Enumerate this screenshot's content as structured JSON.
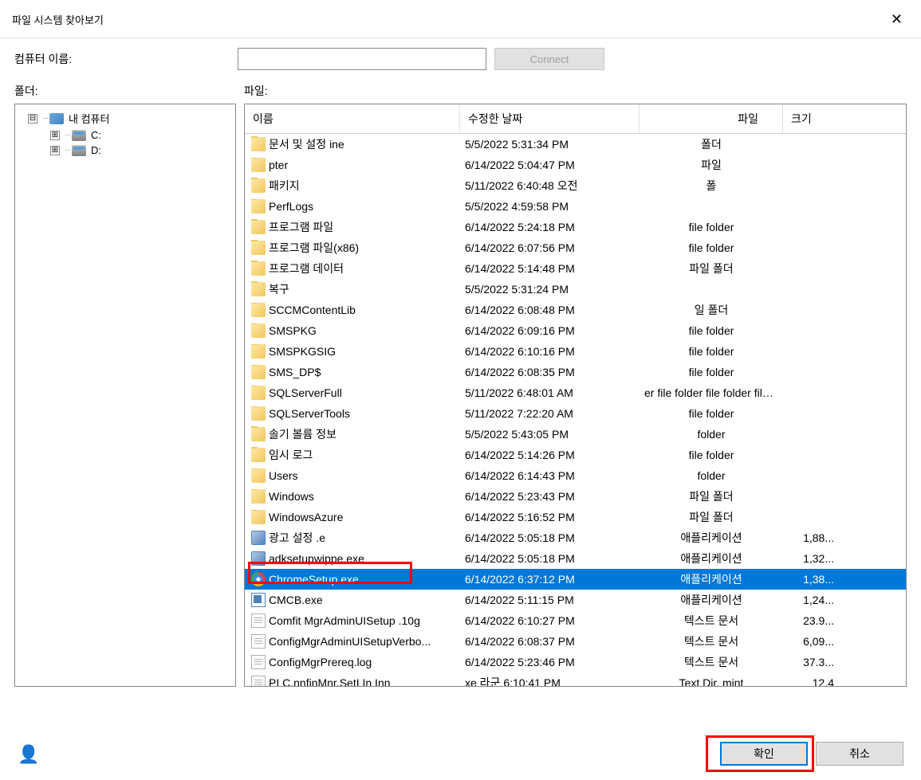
{
  "window": {
    "title": "파일 시스템 찾아보기",
    "close": "✕"
  },
  "labels": {
    "computer_name": "컴퓨터 이름:",
    "folder": "폴더:",
    "file": "파일:"
  },
  "buttons": {
    "connect": "Connect",
    "ok": "확인",
    "cancel": "취소"
  },
  "tree": {
    "root": "내 컴퓨터",
    "expander_minus": "⊟",
    "expander_plus": "⊞",
    "drives": [
      "C:",
      "D:"
    ]
  },
  "columns": {
    "name": "이름",
    "date": "수정한 날짜",
    "type": "파일",
    "size": "크기"
  },
  "files": [
    {
      "name": "문서 및 설정 ine",
      "date": "5/5/2022 5:31:34 PM",
      "type": "폴더",
      "size": "",
      "icon": "folder"
    },
    {
      "name": "pter",
      "date": "6/14/2022 5:04:47 PM",
      "type": "파일",
      "size": "",
      "icon": "folder"
    },
    {
      "name": "패키지",
      "date": "5/11/2022 6:40:48 오전",
      "type": "폴",
      "size": "",
      "icon": "folder"
    },
    {
      "name": "PerfLogs",
      "date": "5/5/2022 4:59:58 PM",
      "type": "",
      "size": "",
      "icon": "folder"
    },
    {
      "name": "프로그램 파일",
      "date": "6/14/2022 5:24:18 PM",
      "type": "file folder",
      "size": "",
      "icon": "folder"
    },
    {
      "name": "프로그램 파일(x86)",
      "date": "6/14/2022 6:07:56 PM",
      "type": "file folder",
      "size": "",
      "icon": "folder"
    },
    {
      "name": "프로그램 데이터",
      "date": "6/14/2022 5:14:48 PM",
      "type": "파일 폴더",
      "size": "",
      "icon": "folder"
    },
    {
      "name": "복구",
      "date": "5/5/2022 5:31:24 PM",
      "type": "",
      "size": "",
      "icon": "folder"
    },
    {
      "name": "SCCMContentLib",
      "date": "6/14/2022 6:08:48 PM",
      "type": "일 폴더",
      "size": "",
      "icon": "folder"
    },
    {
      "name": "SMSPKG",
      "date": "6/14/2022 6:09:16 PM",
      "type": "file folder",
      "size": "",
      "icon": "folder"
    },
    {
      "name": "SMSPKGSIG",
      "date": "6/14/2022 6:10:16 PM",
      "type": "file folder",
      "size": "",
      "icon": "folder"
    },
    {
      "name": "SMS_DP$",
      "date": "6/14/2022 6:08:35 PM",
      "type": "file folder",
      "size": "",
      "icon": "folder"
    },
    {
      "name": "SQLServerFull",
      "date": "5/11/2022 6:48:01 AM",
      "type": "er file folder file folder file folder file folder",
      "size": "",
      "icon": "folder"
    },
    {
      "name": "SQLServerTools",
      "date": "5/11/2022 7:22:20 AM",
      "type": "file folder",
      "size": "",
      "icon": "folder"
    },
    {
      "name": "솔기 볼륨 정보",
      "date": "5/5/2022 5:43:05 PM",
      "type": "folder",
      "size": "",
      "icon": "folder"
    },
    {
      "name": "임시 로그",
      "date": "6/14/2022 5:14:26 PM",
      "type": "file folder",
      "size": "",
      "icon": "folder"
    },
    {
      "name": "Users",
      "date": "6/14/2022 6:14:43 PM",
      "type": "folder",
      "size": "",
      "icon": "folder"
    },
    {
      "name": "Windows",
      "date": "6/14/2022 5:23:43 PM",
      "type": "파일 폴더",
      "size": "",
      "icon": "folder"
    },
    {
      "name": "WindowsAzure",
      "date": "6/14/2022 5:16:52 PM",
      "type": "파일 폴더",
      "size": "",
      "icon": "folder"
    },
    {
      "name": "광고 설정 .e",
      "date": "6/14/2022 5:05:18 PM",
      "type": "애플리케이션",
      "size": "1,88...",
      "icon": "exe"
    },
    {
      "name": "adksetupwippe.exe",
      "date": "6/14/2022 5:05:18 PM",
      "type": "애플리케이션",
      "size": "1,32...",
      "icon": "exe"
    },
    {
      "name": "ChromeSetup.exe",
      "date": "6/14/2022 6:37:12 PM",
      "type": "애플리케이션",
      "size": "1,38...",
      "icon": "chrome",
      "selected": true
    },
    {
      "name": "CMCB.exe",
      "date": "6/14/2022 5:11:15 PM",
      "type": "애플리케이션",
      "size": "1,24...",
      "icon": "app"
    },
    {
      "name": "Comfit MgrAdminUISetup .10g",
      "date": "6/14/2022 6:10:27 PM",
      "type": "텍스트 문서",
      "size": "23.9...",
      "icon": "doc"
    },
    {
      "name": "ConfigMgrAdminUISetupVerbo...",
      "date": "6/14/2022 6:08:37 PM",
      "type": "텍스트 문서",
      "size": "6,09...",
      "icon": "doc"
    },
    {
      "name": "ConfigMgrPrereq.log",
      "date": "6/14/2022 5:23:46 PM",
      "type": "텍스트 문서",
      "size": "37.3...",
      "icon": "doc"
    },
    {
      "name": "PI C.nnfinMnr.SetI In Inn",
      "date": "xe 라군          6:10:41 PM",
      "type": "Text Dir. mint",
      "size": "12.4",
      "icon": "doc"
    }
  ]
}
